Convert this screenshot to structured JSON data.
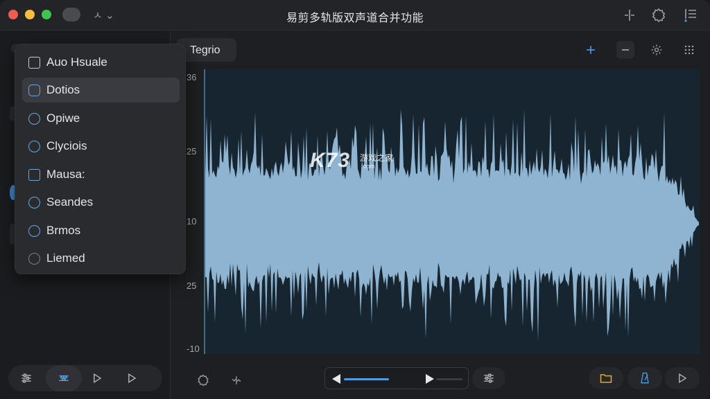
{
  "app": {
    "title": "易剪多轨版双声道合并功能",
    "nav_label": "ㅅ ⌄"
  },
  "dropdown": {
    "items": [
      {
        "label": "Auo Hsuale",
        "marker": "checkbox"
      },
      {
        "label": "Dotios",
        "marker": "checkbox",
        "selected": true
      },
      {
        "label": "Opiwe",
        "marker": "radio"
      },
      {
        "label": "Clyciois",
        "marker": "radio"
      },
      {
        "label": "Mausa:",
        "marker": "checkbox"
      },
      {
        "label": "Seandes",
        "marker": "radio"
      },
      {
        "label": "Brmos",
        "marker": "radio"
      },
      {
        "label": "Liemed",
        "marker": "radio"
      }
    ]
  },
  "main": {
    "tab_label": "Tegrio",
    "y_axis_labels": [
      "36",
      "25",
      "10",
      "25",
      "-10"
    ]
  },
  "watermark": {
    "brand": "K73",
    "cn_text": "游戏之家",
    "url": ".com"
  },
  "transport": {
    "progress": 0.55
  },
  "colors": {
    "accent": "#4b9be6",
    "waveform": "#8fb4d1",
    "folder": "#e4a93c"
  },
  "icons": {
    "sidebar_bottom": [
      "sliders-icon",
      "waveform-edit-icon",
      "play-outline-icon",
      "play-outline-icon"
    ],
    "toolbar": [
      "plus-icon",
      "minus-icon",
      "gear-icon",
      "grid-icon"
    ],
    "bottom_bar": [
      "gear-icon",
      "split-icon",
      "sliders-icon",
      "folder-icon",
      "metronome-icon",
      "play-outline-icon"
    ]
  }
}
